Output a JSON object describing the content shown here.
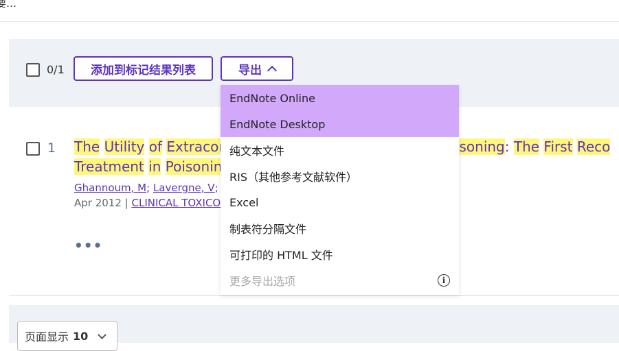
{
  "top_snippet": "要…",
  "toolbar": {
    "selected_count": "0/1",
    "add_to_marked_label": "添加到标记结果列表",
    "export_label": "导出"
  },
  "export_menu": {
    "items": [
      {
        "label": "EndNote Online"
      },
      {
        "label": "EndNote Desktop"
      },
      {
        "label": "纯文本文件"
      },
      {
        "label": "RIS（其他参考文献软件）"
      },
      {
        "label": "Excel"
      },
      {
        "label": "制表符分隔文件"
      },
      {
        "label": "可打印的 HTML 文件"
      },
      {
        "label": "更多导出选项"
      }
    ],
    "info_icon": "info-icon"
  },
  "result": {
    "index": "1",
    "title_line1_a": "The",
    "title_line1_b": "Utility",
    "title_line1_c": "of",
    "title_line1_d": "Extracorp",
    "title_line1_e": "Poisoning",
    "title_line1_f": ":",
    "title_line1_g": "The",
    "title_line1_h": "First",
    "title_line1_i": "Reco",
    "title_line2_a": "Treatment",
    "title_line2_b": "in",
    "title_line2_c": "Poisoning",
    "author1": "Ghannoum, M",
    "author_sep": "; ",
    "author2": "Lavergne, V",
    "author_rest": "; (…",
    "date": "Apr 2012 | ",
    "journal": "CLINICAL TOXICOLO",
    "more": "•••"
  },
  "footer": {
    "page_size_label": "页面显示",
    "page_size_value": "10"
  },
  "colors": {
    "accent": "#5e33bf",
    "highlight": "#fff77a",
    "menu_highlight": "#d2a8fb",
    "toolbar_bg": "#eef1f6"
  }
}
